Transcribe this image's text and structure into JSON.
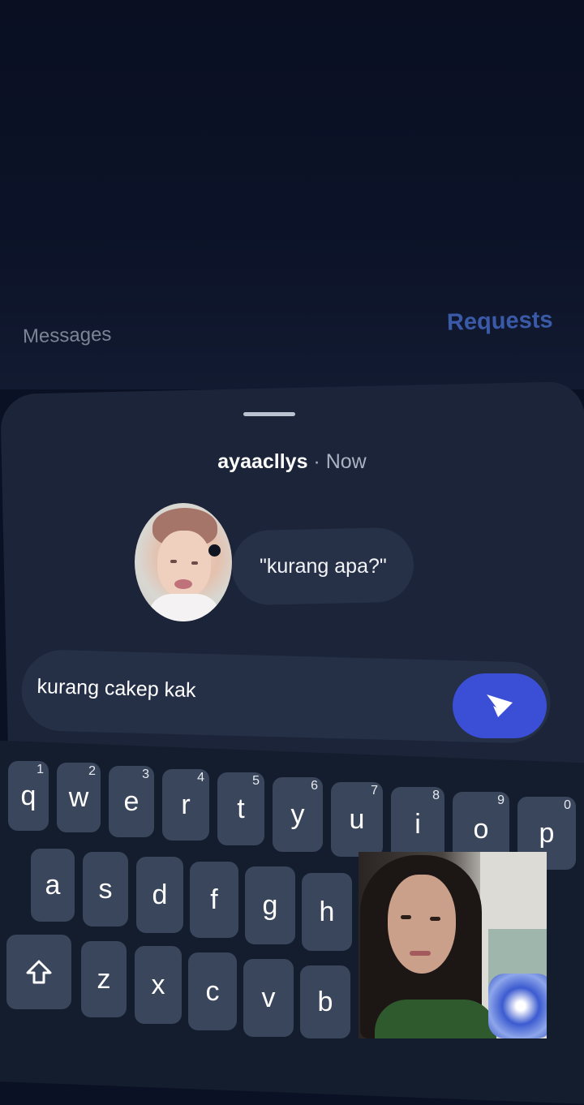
{
  "tabs": {
    "messages": "Messages",
    "requests": "Requests"
  },
  "sheet": {
    "username": "ayaacllys",
    "separator": " · ",
    "time": "Now",
    "question": "\"kurang apa?\""
  },
  "reply": {
    "text": "kurang cakep kak"
  },
  "keyboard": {
    "row1": [
      {
        "k": "q",
        "n": "1"
      },
      {
        "k": "w",
        "n": "2"
      },
      {
        "k": "e",
        "n": "3"
      },
      {
        "k": "r",
        "n": "4"
      },
      {
        "k": "t",
        "n": "5"
      },
      {
        "k": "y",
        "n": "6"
      },
      {
        "k": "u",
        "n": "7"
      },
      {
        "k": "i",
        "n": "8"
      },
      {
        "k": "o",
        "n": "9"
      },
      {
        "k": "p",
        "n": "0"
      }
    ],
    "row2": [
      "a",
      "s",
      "d",
      "f",
      "g",
      "h"
    ],
    "row3": [
      "z",
      "x",
      "c",
      "v",
      "b"
    ]
  },
  "icons": {
    "send": "send-icon",
    "shift": "shift-icon"
  },
  "colors": {
    "accent": "#3a4fd6",
    "sheet": "#1b2438",
    "requests": "#3a5aa8"
  }
}
